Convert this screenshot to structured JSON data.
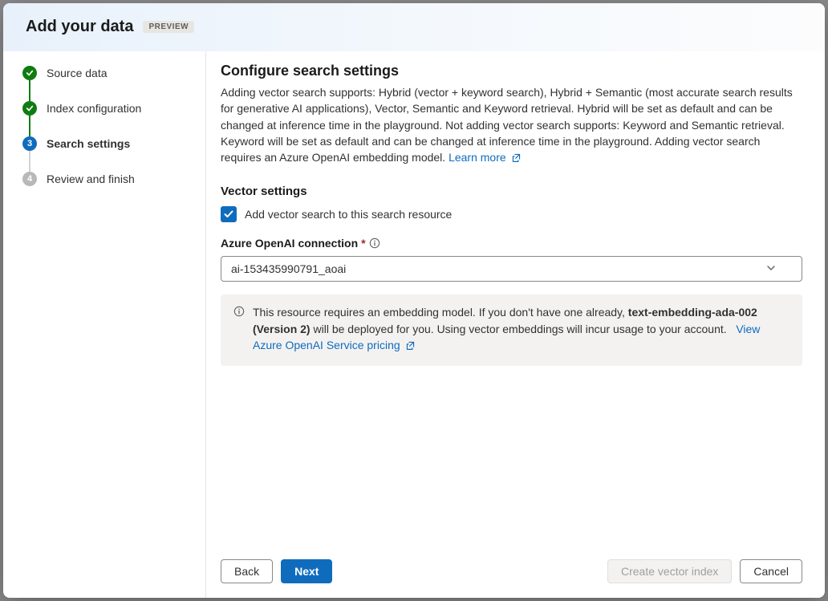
{
  "header": {
    "title": "Add your data",
    "badge": "PREVIEW"
  },
  "steps": [
    {
      "label": "Source data",
      "state": "done"
    },
    {
      "label": "Index configuration",
      "state": "done"
    },
    {
      "label": "Search settings",
      "state": "active"
    },
    {
      "label": "Review and finish",
      "state": "pending"
    }
  ],
  "content": {
    "title": "Configure search settings",
    "description": "Adding vector search supports: Hybrid (vector + keyword search), Hybrid + Semantic (most accurate search results for generative AI applications), Vector, Semantic and Keyword retrieval. Hybrid will be set as default and can be changed at inference time in the playground. Not adding vector search supports: Keyword and Semantic retrieval. Keyword will be set as default and can be changed at inference time in the playground. Adding vector search requires an Azure OpenAI embedding model.",
    "learn_more": "Learn more",
    "vector_title": "Vector settings",
    "checkbox_label": "Add vector search to this search resource",
    "checkbox_checked": true,
    "connection_label": "Azure OpenAI connection",
    "connection_value": "ai-153435990791_aoai",
    "info_text_1": "This resource requires an embedding model. If you don't have one already, ",
    "info_bold": "text-embedding-ada-002 (Version 2)",
    "info_text_2": " will be deployed for you. Using vector embeddings will incur usage to your account.",
    "pricing_link": "View Azure OpenAI Service pricing"
  },
  "footer": {
    "back": "Back",
    "next": "Next",
    "create": "Create vector index",
    "cancel": "Cancel"
  }
}
